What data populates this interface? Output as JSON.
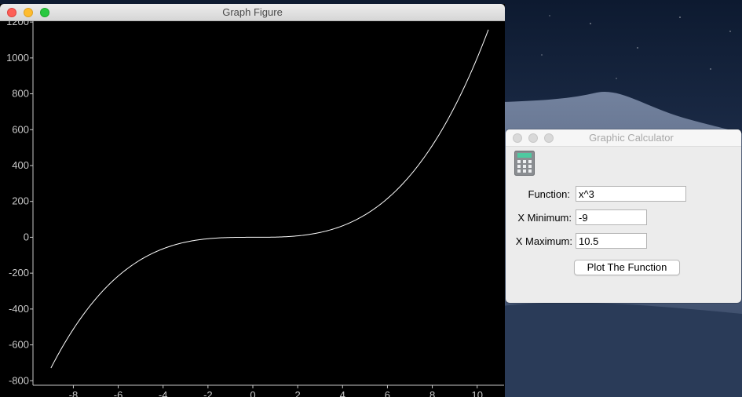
{
  "graph_window": {
    "title": "Graph Figure"
  },
  "calculator_window": {
    "title": "Graphic Calculator",
    "function_label": "Function:",
    "function_value": "x^3",
    "xmin_label": "X Minimum:",
    "xmin_value": "-9",
    "xmax_label": "X Maximum:",
    "xmax_value": "10.5",
    "plot_button_label": "Plot The Function",
    "icon": "calculator-icon"
  },
  "chart_data": {
    "type": "line",
    "function": "x^3",
    "x_range": [
      -9,
      10.5
    ],
    "xlim": [
      -9.8,
      11.2
    ],
    "ylim": [
      -825,
      1205
    ],
    "x_ticks": [
      -8,
      -6,
      -4,
      -2,
      0,
      2,
      4,
      6,
      8,
      10
    ],
    "y_ticks": [
      -800,
      -600,
      -400,
      -200,
      0,
      200,
      400,
      600,
      800,
      1000,
      1200
    ],
    "series": [
      {
        "color": "#ffffff"
      }
    ],
    "grid": false,
    "background": "#000000",
    "tick_color": "#c8c8c8"
  },
  "desktop": {
    "sky_top": "#0d1a30",
    "sky_bottom": "#3f5372"
  }
}
